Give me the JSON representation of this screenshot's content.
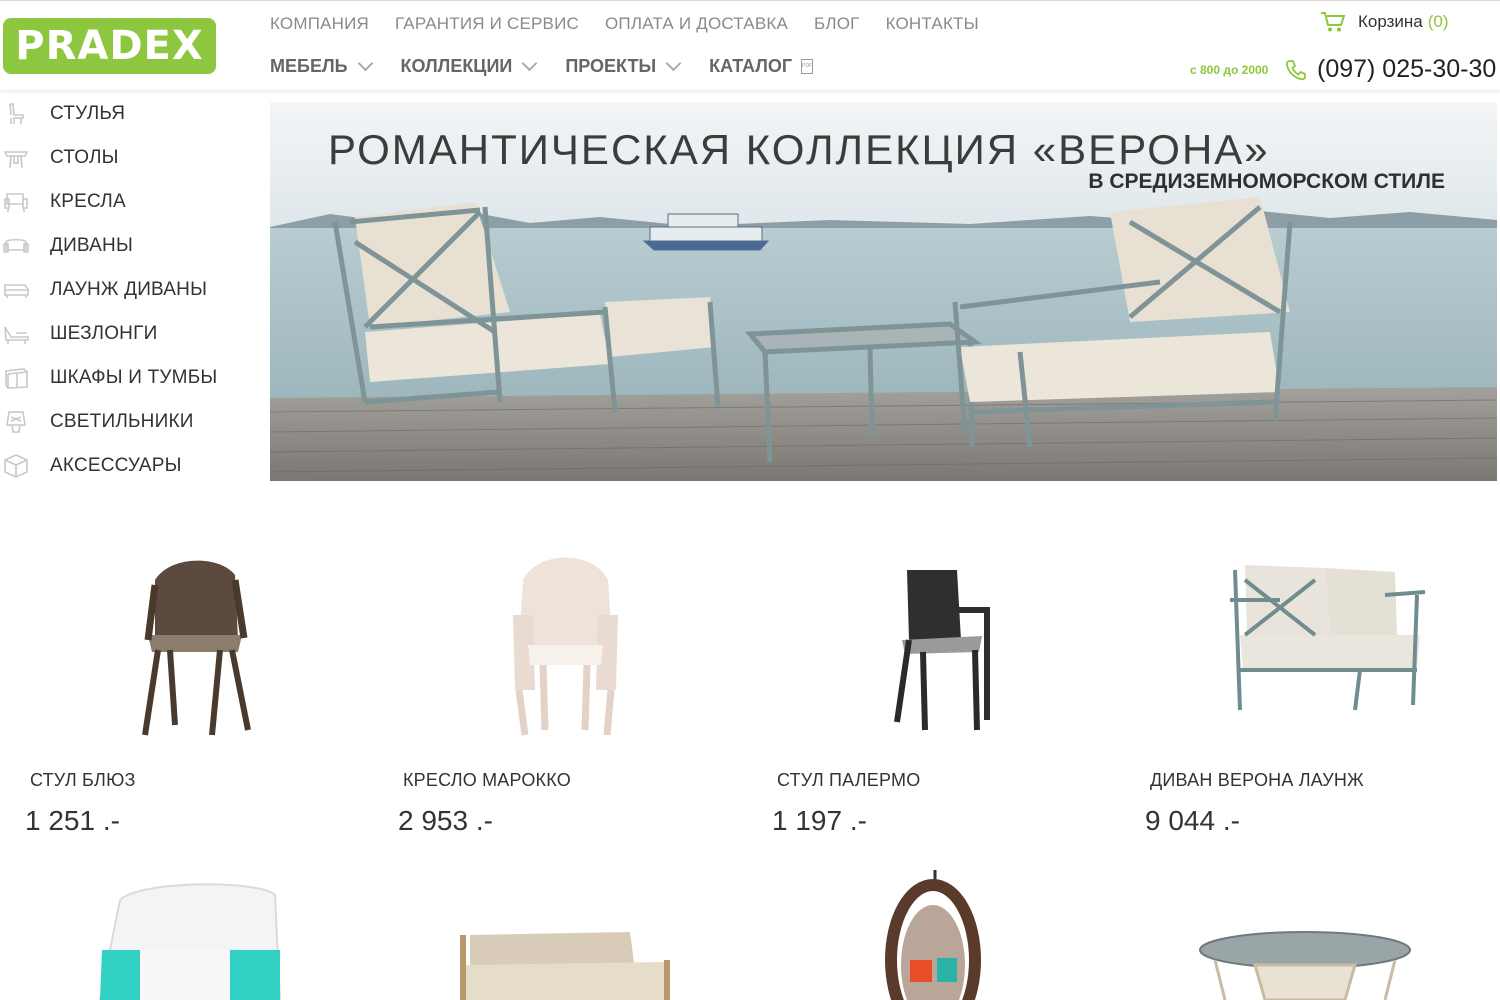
{
  "logo": {
    "text": "PRADEX"
  },
  "top_nav": [
    "КОМПАНИЯ",
    "ГАРАНТИЯ И СЕРВИС",
    "ОПЛАТА И ДОСТАВКА",
    "БЛОГ",
    "КОНТАКТЫ"
  ],
  "main_nav": [
    {
      "label": "МЕБЕЛЬ",
      "icon": "chevron-down-icon"
    },
    {
      "label": "КОЛЛЕКЦИИ",
      "icon": "chevron-down-icon"
    },
    {
      "label": "ПРОЕКТЫ",
      "icon": "chevron-down-icon"
    },
    {
      "label": "КАТАЛОГ",
      "icon": "pdf-icon"
    }
  ],
  "cart": {
    "label": "Корзина",
    "count": "(0)"
  },
  "hours": "с 800 до 2000",
  "phone": "(097) 025-30-30",
  "sidebar": [
    {
      "label": "СТУЛЬЯ",
      "icon": "chair-icon"
    },
    {
      "label": "СТОЛЫ",
      "icon": "table-icon"
    },
    {
      "label": "КРЕСЛА",
      "icon": "armchair-icon"
    },
    {
      "label": "ДИВАНЫ",
      "icon": "sofa-icon"
    },
    {
      "label": "ЛАУНЖ ДИВАНЫ",
      "icon": "lounge-sofa-icon"
    },
    {
      "label": "ШЕЗЛОНГИ",
      "icon": "sunlounger-icon"
    },
    {
      "label": "ШКАФЫ И ТУМБЫ",
      "icon": "cabinet-icon"
    },
    {
      "label": "СВЕТИЛЬНИКИ",
      "icon": "lamp-icon"
    },
    {
      "label": "АКСЕССУАРЫ",
      "icon": "accessory-box-icon"
    }
  ],
  "banner": {
    "title": "РОМАНТИЧЕСКАЯ КОЛЛЕКЦИЯ «ВЕРОНА»",
    "subtitle": "В СРЕДИЗЕМНОМОРСКОМ СТИЛЕ"
  },
  "products": [
    {
      "name": "СТУЛ БЛЮЗ",
      "price": "1 251 .-"
    },
    {
      "name": "КРЕСЛО МАРОККО",
      "price": "2 953 .-"
    },
    {
      "name": "СТУЛ ПАЛЕРМО",
      "price": "1 197 .-"
    },
    {
      "name": "ДИВАН ВЕРОНА ЛАУНЖ",
      "price": "9 044 .-"
    }
  ],
  "colors": {
    "brand_green": "#8dc63f",
    "text": "#333333",
    "nav_gray": "#8a8a8a"
  }
}
